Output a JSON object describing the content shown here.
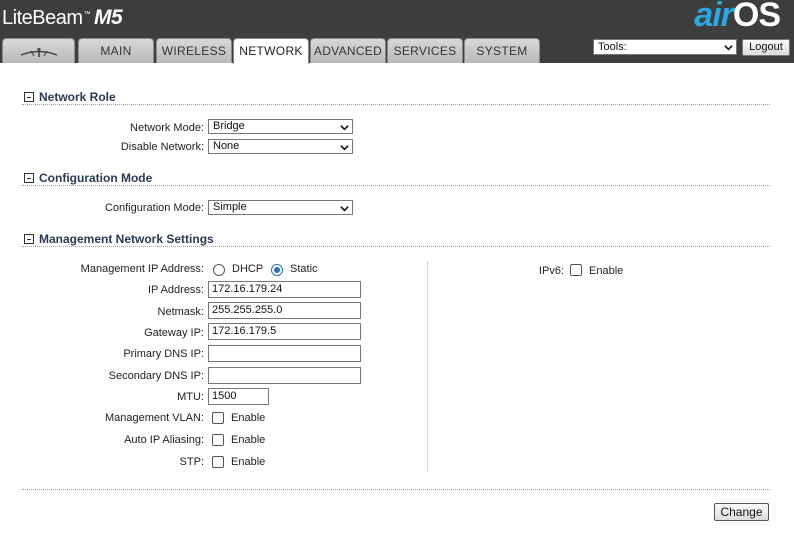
{
  "header": {
    "brand": "LiteBeam",
    "trademark": "™",
    "model": "M5",
    "logo_air": "air",
    "logo_os": "OS"
  },
  "tabs": [
    {
      "label": "",
      "icon": "ubiquiti-logo-icon"
    },
    {
      "label": "MAIN"
    },
    {
      "label": "WIRELESS"
    },
    {
      "label": "NETWORK",
      "active": true
    },
    {
      "label": "ADVANCED"
    },
    {
      "label": "SERVICES"
    },
    {
      "label": "SYSTEM"
    }
  ],
  "toolbar": {
    "tools_value": "Tools:",
    "logout_label": "Logout"
  },
  "network_role": {
    "title": "Network Role",
    "network_mode_label": "Network Mode:",
    "network_mode_value": "Bridge",
    "disable_network_label": "Disable Network:",
    "disable_network_value": "None"
  },
  "configuration_mode": {
    "title": "Configuration Mode",
    "label": "Configuration Mode:",
    "value": "Simple"
  },
  "management": {
    "title": "Management Network Settings",
    "ip_mode_label": "Management IP Address:",
    "dhcp_label": "DHCP",
    "static_label": "Static",
    "ip_label": "IP Address:",
    "ip_value": "172.16.179.24",
    "netmask_label": "Netmask:",
    "netmask_value": "255.255.255.0",
    "gateway_label": "Gateway IP:",
    "gateway_value": "172.16.179.5",
    "primary_dns_label": "Primary DNS IP:",
    "primary_dns_value": "",
    "secondary_dns_label": "Secondary DNS IP:",
    "secondary_dns_value": "",
    "mtu_label": "MTU:",
    "mtu_value": "1500",
    "vlan_label": "Management VLAN:",
    "alias_label": "Auto IP Aliasing:",
    "stp_label": "STP:",
    "enable_label": "Enable",
    "ipv6_label": "IPv6:"
  },
  "change_label": "Change"
}
